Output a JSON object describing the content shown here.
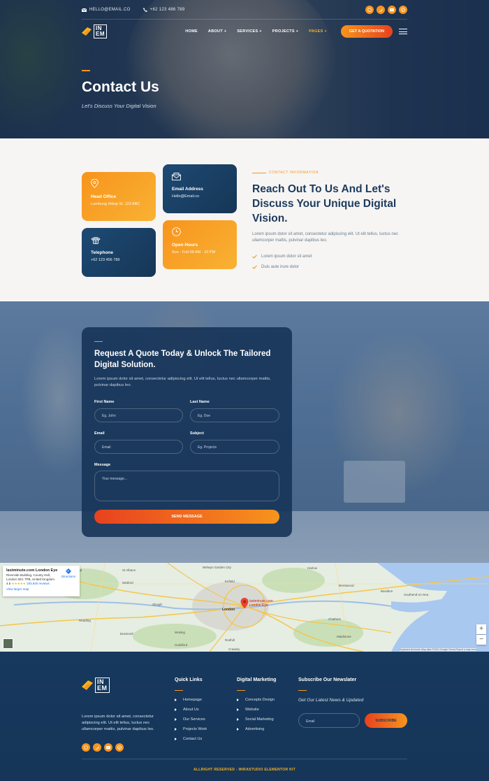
{
  "topbar": {
    "email": "HELLO@EMAIL.CO",
    "phone": "+62 123 486 789"
  },
  "brand": {
    "logo_text_line1": "IN",
    "logo_text_line2": "EM"
  },
  "nav": {
    "items": [
      "HOME",
      "ABOUT",
      "SERVICES",
      "PROJECTS",
      "PAGES"
    ],
    "active": "PAGES",
    "cta": "GET A QUOTATION"
  },
  "hero": {
    "title": "Contact Us",
    "subtitle": "Let's Discuss Your Digital Vision"
  },
  "cards": [
    {
      "title": "Head Office",
      "value": "Lumbung Hidup St. 123 ABC",
      "icon": "location-pin-icon"
    },
    {
      "title": "Email Address",
      "value": "Hello@Email.co",
      "icon": "envelope-icon"
    },
    {
      "title": "Telephone",
      "value": "+62 123 456 789",
      "icon": "telephone-icon"
    },
    {
      "title": "Open Hours",
      "value": "Sun - Frid 08 AM - 10 PM",
      "icon": "clock-icon"
    }
  ],
  "info": {
    "eyebrow": "CONTACT INFORMATION",
    "title": "Reach Out To Us And Let's Discuss Your Unique Digital Vision.",
    "desc": "Lorem ipsum dolor sit amet, consectetur adipiscing elit. Ut elit tellus, luctus nec ullamcorper mattis, pulvinar dapibus leo.",
    "checks": [
      "Lorem ipsum dolor sit amet",
      "Duis aute irure dolor"
    ]
  },
  "form": {
    "title": "Request A Quote Today & Unlock The Tailored Digital Solution.",
    "desc": "Lorem ipsum dolor sit amet, consectetur adipiscing elit. Ut elit tellus, luctus nec ullamcorper mattis, pulvinar dapibus leo.",
    "first_name_label": "First Name",
    "first_name_placeholder": "Eg. John",
    "last_name_label": "Last Name",
    "last_name_placeholder": "Eg. Doe",
    "email_label": "Email",
    "email_placeholder": "Email",
    "subject_label": "Subject",
    "subject_placeholder": "Eg. Projects",
    "message_label": "Message",
    "message_placeholder": "Your message...",
    "submit": "SEND MESSAGE"
  },
  "map": {
    "place": "lastminute.com London Eye",
    "address": "Riverside Building, County Hall, London SE1 7PB, United Kingdom",
    "rating": "4.5",
    "stars": "★★★★★",
    "reviews": "193,940 reviews",
    "directions": "Directions",
    "larger": "View larger map",
    "pin_label": "lastminute.com London Eye",
    "towns": [
      "Hemel Hempstead",
      "St Albans",
      "Welwyn Garden City",
      "Harlow",
      "Watford",
      "Enfield",
      "Brentwood",
      "Slough",
      "London",
      "Basildon",
      "Southend-on-Sea",
      "Reading",
      "Bracknell",
      "Woking",
      "Guildford",
      "Redhill",
      "Chatham",
      "Maidstone",
      "Crawley"
    ],
    "attribution": "Keyboard shortcuts  Map data ©2024 Google  Terms  Report a map error"
  },
  "footer": {
    "desc": "Lorem ipsum dolor sit amet, consectetur adipiscing elit. Ut elit tellus, luctus nec ullamcorper mattis, pulvinar dapibus leo.",
    "quick_title": "Quick Links",
    "quick_links": [
      "Homepage",
      "About Us",
      "Our Services",
      "Projects Work",
      "Contact Us"
    ],
    "digital_title": "Digital Marketing",
    "digital_links": [
      "Concepts Design",
      "Website",
      "Social Marketing",
      "Advertising"
    ],
    "newsletter_title": "Subscribe Our Newslater",
    "newsletter_sub": "Get Our Latest News & Updated",
    "email_placeholder": "Email",
    "subscribe": "SUBSCRIBE",
    "copyright": "ALLRIGHT RESERVED - WIRASTUDIO ELEMENTOR KIT"
  },
  "colors": {
    "accent": "#f7941d",
    "accent_red": "#e8411f",
    "navy": "#163656",
    "text_dark": "#1d3a5c"
  },
  "social_icons": [
    "dribbble-icon",
    "twitter-icon",
    "youtube-icon",
    "pinterest-icon"
  ]
}
